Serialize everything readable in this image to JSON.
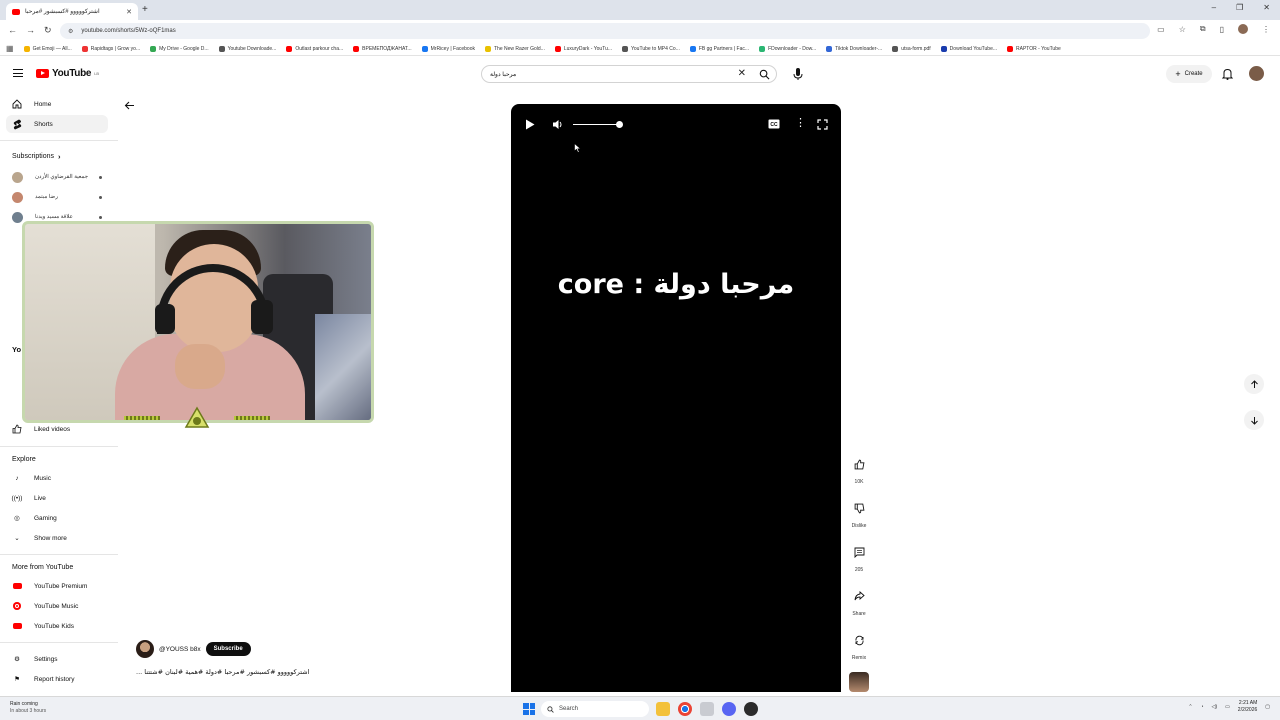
{
  "browser": {
    "tab_title": "اشتركووووو #كسبشور #مرحبا",
    "url": "youtube.com/shorts/5Wz-oQF1mas",
    "bookmarks": [
      "Get Emoji — All...",
      "Rapidtags | Grow yo...",
      "My Drive - Google D...",
      "Youtube Downloade...",
      "Outlast parkour cha...",
      "ВРЕМЕПОДЖАНАТ...",
      "MrRicey | Facebook",
      "The New Razer Gold...",
      "LuxuryDark - YouTu...",
      "YouTube to MP4 Co...",
      "FB gg Partners | Fac...",
      "FDownloader - Dow...",
      "Tiktok Downloader-...",
      "utsa-form.pdf",
      "Download YouTube...",
      "RAPTOR - YouTube"
    ]
  },
  "header": {
    "logo_text": "YouTube",
    "logo_sup": "LB",
    "search_value": "مرحبا دولة",
    "create_label": "Create"
  },
  "sidebar": {
    "home": "Home",
    "shorts": "Shorts",
    "subscriptions_heading": "Subscriptions",
    "subs": [
      "جمعية القرضاوي الأردن",
      "رضا مبتمد",
      "علاقة مسيد ويدنا"
    ],
    "you_heading": "Yo",
    "liked": "Liked videos",
    "explore_heading": "Explore",
    "explore": [
      "Music",
      "Live",
      "Gaming",
      "Show more"
    ],
    "more_heading": "More from YouTube",
    "more": [
      "YouTube Premium",
      "YouTube Music",
      "YouTube Kids"
    ],
    "settings": "Settings",
    "report": "Report history"
  },
  "player": {
    "overlay_text": "core : مرحبا دولة"
  },
  "actions": {
    "likes": "10K",
    "dislike": "Dislike",
    "comments": "205",
    "share": "Share",
    "remix": "Remix"
  },
  "channel": {
    "handle": "@YOUSS b8x",
    "subscribe_label": "Subscribe",
    "description": "... اشتركووووو #كسبشور #مرحبا #دولة #همية #لبنان #شتتنا"
  },
  "taskbar": {
    "weather_title": "Rain coming",
    "weather_sub": "In about 3 hours",
    "search_label": "Search",
    "time": "2:21 AM",
    "date": "2/2/2026"
  }
}
